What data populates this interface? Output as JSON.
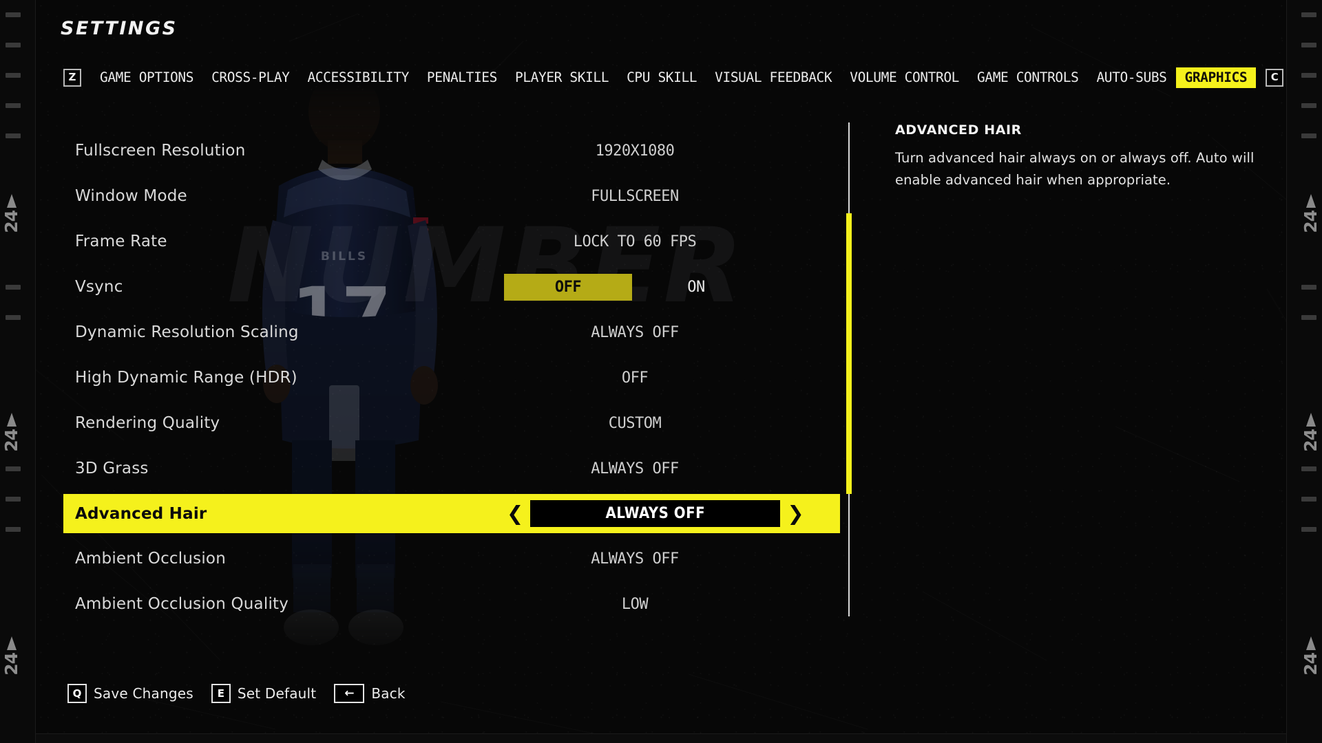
{
  "header": {
    "title": "SETTINGS"
  },
  "theme": {
    "accent": "#f5f11c",
    "accent_dim": "#b5ab16",
    "background": "#070707",
    "text": "#d9d9d9",
    "rail": "#0a0a0a"
  },
  "background": {
    "wordmark": "NUMBER",
    "player_jersey_number": "17",
    "player_team_text": "BILLS"
  },
  "tabs": {
    "prev_key": "Z",
    "next_key": "C",
    "items": [
      {
        "label": "GAME OPTIONS",
        "active": false
      },
      {
        "label": "CROSS-PLAY",
        "active": false
      },
      {
        "label": "ACCESSIBILITY",
        "active": false
      },
      {
        "label": "PENALTIES",
        "active": false
      },
      {
        "label": "PLAYER SKILL",
        "active": false
      },
      {
        "label": "CPU SKILL",
        "active": false
      },
      {
        "label": "VISUAL FEEDBACK",
        "active": false
      },
      {
        "label": "VOLUME CONTROL",
        "active": false
      },
      {
        "label": "GAME CONTROLS",
        "active": false
      },
      {
        "label": "AUTO-SUBS",
        "active": false
      },
      {
        "label": "GRAPHICS",
        "active": true
      }
    ]
  },
  "settings": {
    "rows": [
      {
        "label": "Fullscreen Resolution",
        "value": "1920X1080",
        "type": "value",
        "focused": false
      },
      {
        "label": "Window Mode",
        "value": "FULLSCREEN",
        "type": "value",
        "focused": false
      },
      {
        "label": "Frame Rate",
        "value": "LOCK TO 60 FPS",
        "type": "value",
        "focused": false
      },
      {
        "label": "Vsync",
        "type": "segmented",
        "focused": false,
        "options": [
          "OFF",
          "ON"
        ],
        "selected": "OFF"
      },
      {
        "label": "Dynamic Resolution Scaling",
        "value": "ALWAYS OFF",
        "type": "value",
        "focused": false
      },
      {
        "label": "High Dynamic Range (HDR)",
        "value": "OFF",
        "type": "value",
        "focused": false
      },
      {
        "label": "Rendering Quality",
        "value": "CUSTOM",
        "type": "value",
        "focused": false
      },
      {
        "label": "3D Grass",
        "value": "ALWAYS OFF",
        "type": "value",
        "focused": false
      },
      {
        "label": "Advanced Hair",
        "value": "ALWAYS OFF",
        "type": "stepper",
        "focused": true,
        "prev_icon": "chevron-left-icon",
        "next_icon": "chevron-right-icon"
      },
      {
        "label": "Ambient Occlusion",
        "value": "ALWAYS OFF",
        "type": "value",
        "focused": false
      },
      {
        "label": "Ambient Occlusion Quality",
        "value": "LOW",
        "type": "value",
        "focused": false
      }
    ]
  },
  "description": {
    "title": "ADVANCED HAIR",
    "body": "Turn advanced hair always on or always off. Auto will enable advanced hair when appropriate."
  },
  "actions": [
    {
      "key": "Q",
      "label": "Save Changes",
      "icon": "key-q-icon"
    },
    {
      "key": "E",
      "label": "Set Default",
      "icon": "key-e-icon"
    },
    {
      "key": "←",
      "label": "Back",
      "icon": "arrow-left-icon",
      "wide": true
    }
  ],
  "rails": {
    "number": "24",
    "marker_icon": "triangle-up-icon"
  }
}
